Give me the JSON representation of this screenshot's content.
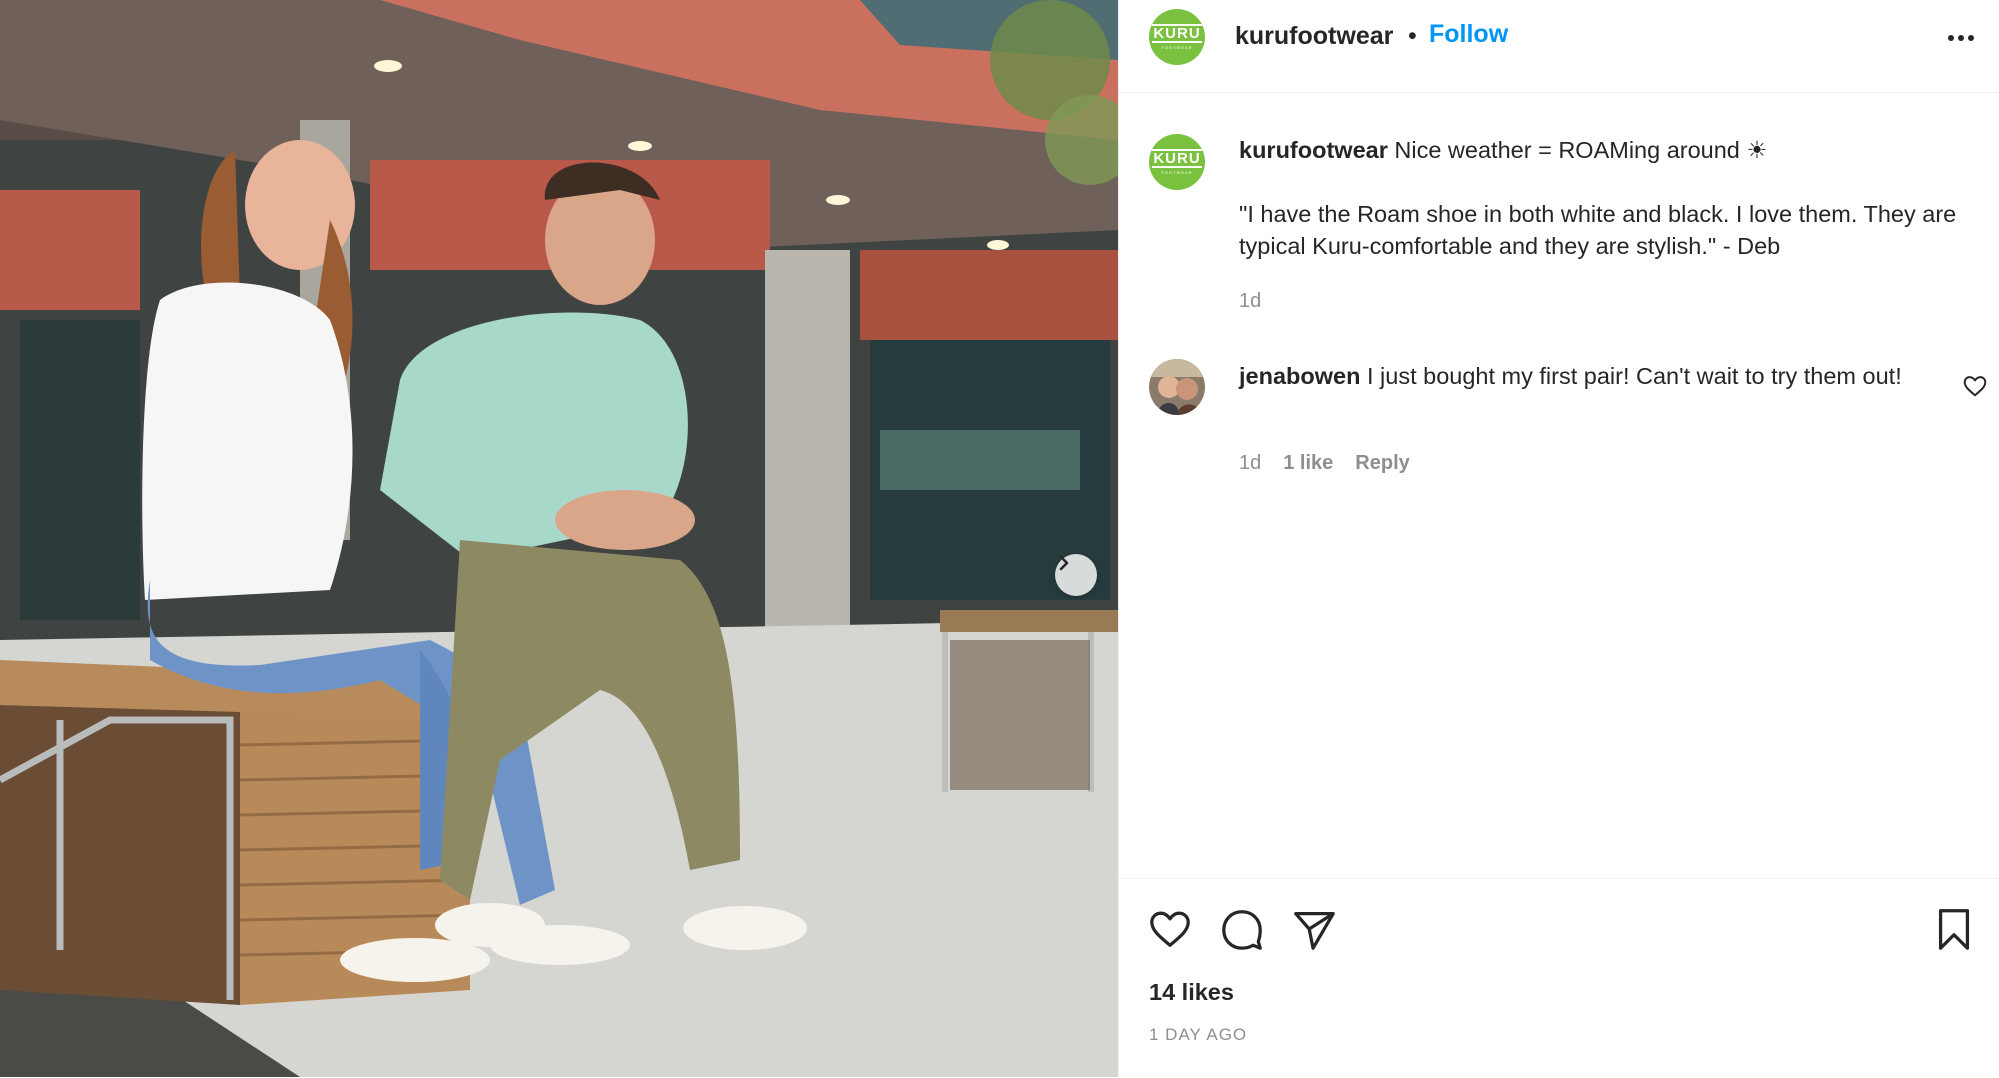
{
  "header": {
    "username": "kurufootwear",
    "separator": "•",
    "follow_label": "Follow"
  },
  "logo": {
    "text": "KURU",
    "subtext": "FOOTWEAR",
    "color": "#7ac13f"
  },
  "caption": {
    "username": "kurufootwear",
    "text": "Nice weather = ROAMing around ☀",
    "quote": "\"I have the Roam shoe in both white and black. I love them. They are typical Kuru-comfortable and they are stylish.\" - Deb",
    "time": "1d"
  },
  "comment": {
    "username": "jenabowen",
    "text": "I just bought my first pair! Can't wait to try them out!",
    "time": "1d",
    "likes_label": "1 like",
    "reply_label": "Reply"
  },
  "footer": {
    "likes": "14 likes",
    "date": "1 DAY AGO"
  },
  "icons": {
    "more": "more-horizontal-icon",
    "next": "chevron-right-icon",
    "like": "heart-icon",
    "comment": "comment-icon",
    "share": "paper-plane-icon",
    "save": "bookmark-icon"
  },
  "colors": {
    "accent": "#0095f6",
    "muted": "#8e8e8e",
    "text": "#262626"
  }
}
